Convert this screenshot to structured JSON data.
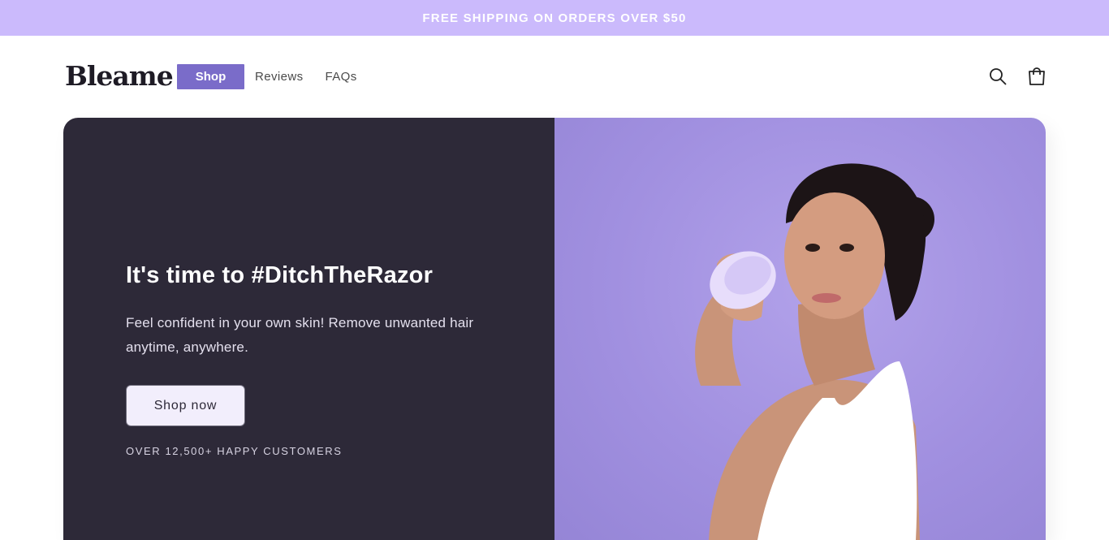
{
  "announcement": {
    "text": "FREE SHIPPING ON ORDERS OVER $50"
  },
  "header": {
    "logo": "Bleame",
    "nav": [
      {
        "label": "Shop",
        "active": true
      },
      {
        "label": "Reviews",
        "active": false
      },
      {
        "label": "FAQs",
        "active": false
      }
    ],
    "icons": [
      "search-icon",
      "cart-icon"
    ]
  },
  "hero": {
    "title": "It's time to #DitchTheRazor",
    "text": "Feel confident in your own skin! Remove unwanted hair anytime, anywhere.",
    "button_label": "Shop now",
    "subtext": "OVER 12,500+ HAPPY CUSTOMERS",
    "image": "woman-holding-hair-removal-device"
  },
  "colors": {
    "announcement_bg": "#cbbafc",
    "nav_active_bg": "#7a6cc9",
    "hero_dark_bg": "#2d2938",
    "hero_image_bg": "#a190e0",
    "button_bg": "#f2eefc"
  }
}
